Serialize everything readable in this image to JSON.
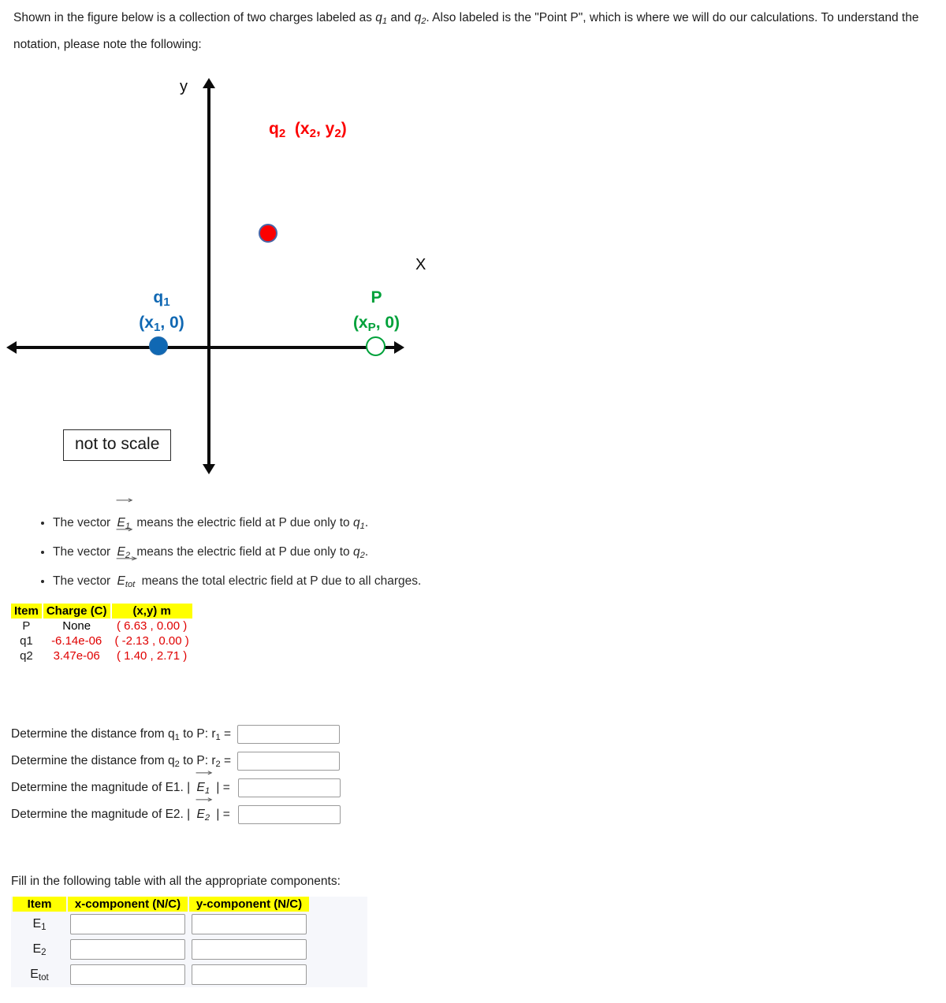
{
  "intro": {
    "line1_a": "Shown in the figure below is a collection of two charges labeled as ",
    "q1": "q",
    "q1_sub": "1",
    "line1_b": " and ",
    "q2": "q",
    "q2_sub": "2",
    "line1_c": ". Also labeled is the \"Point P\", which is where we will do our calculations. To understand the notation, please note the following:"
  },
  "figure": {
    "axis_label_y": "y",
    "axis_label_x": "X",
    "q2_label": "q",
    "q2_label_sub": "2",
    "q2_coords": "(x",
    "q2_coords_sub1": "2",
    "q2_coords_mid": ", y",
    "q2_coords_sub2": "2",
    "q2_coords_end": ")",
    "q1_label": "q",
    "q1_label_sub": "1",
    "q1_coords_a": "(x",
    "q1_coords_sub": "1",
    "q1_coords_b": ", 0)",
    "p_label": "P",
    "p_coords_a": "(x",
    "p_coords_sub": "P",
    "p_coords_b": ", 0)",
    "not_to_scale": "not to scale",
    "colors": {
      "q1": "#1068b3",
      "q2": "#fc0000",
      "p": "#00a13a",
      "axis": "#0b0b0b"
    }
  },
  "bullets": [
    {
      "pre": "The vector ",
      "sym": "E",
      "sub": "1",
      "post": " means the electric field at P due only to ",
      "tail_sym": "q",
      "tail_sub": "1",
      "tail_end": "."
    },
    {
      "pre": "The vector ",
      "sym": "E",
      "sub": "2",
      "post": " means the electric field at P due only to ",
      "tail_sym": "q",
      "tail_sub": "2",
      "tail_end": "."
    },
    {
      "pre": "The vector ",
      "sym": "E",
      "sub": "tot",
      "post": " means the total electric field at P due to all charges.",
      "tail_sym": "",
      "tail_sub": "",
      "tail_end": ""
    }
  ],
  "charge_table": {
    "headers": [
      "Item",
      "Charge (C)",
      "(x,y) m"
    ],
    "rows": [
      {
        "item": "P",
        "charge": "None",
        "coords": "( 6.63 , 0.00 )"
      },
      {
        "item": "q1",
        "charge": "-6.14e-06",
        "coords": "( -2.13 , 0.00 )"
      },
      {
        "item": "q2",
        "charge": "3.47e-06",
        "coords": "( 1.40 , 2.71 )"
      }
    ]
  },
  "determine": [
    {
      "prefix": "Determine the distance from q",
      "sub1": "1",
      "mid": " to P: r",
      "sub2": "1",
      "eq": " =",
      "value": "",
      "style": "plain"
    },
    {
      "prefix": "Determine the distance from q",
      "sub1": "2",
      "mid": " to P: r",
      "sub2": "2",
      "eq": " =",
      "value": "",
      "style": "plain"
    },
    {
      "prefix": "Determine the magnitude of E1.  | ",
      "sub1": "",
      "mid": "",
      "sub2": "1",
      "eq": " | =",
      "value": "",
      "style": "vector"
    },
    {
      "prefix": "Determine the magnitude of E2.  | ",
      "sub1": "",
      "mid": "",
      "sub2": "2",
      "eq": " | =",
      "value": "",
      "style": "vector"
    }
  ],
  "fill_section": {
    "intro": "Fill in the following table with all the appropriate components:",
    "headers": [
      "Item",
      "x-component (N/C)",
      "y-component (N/C)"
    ],
    "rows": [
      {
        "label": "E",
        "sub": "1",
        "x_value": "",
        "y_value": ""
      },
      {
        "label": "E",
        "sub": "2",
        "x_value": "",
        "y_value": ""
      },
      {
        "label": "E",
        "sub": "tot",
        "x_value": "",
        "y_value": ""
      }
    ]
  }
}
